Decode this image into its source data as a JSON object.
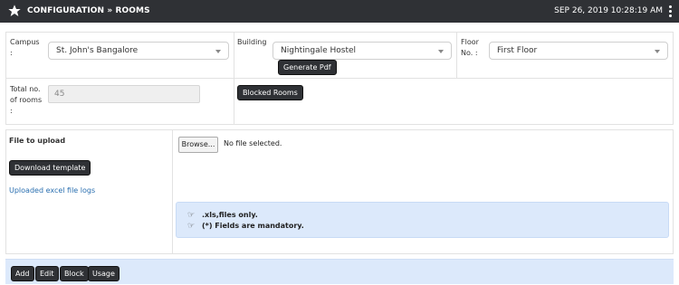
{
  "header": {
    "title": "CONFIGURATION » ROOMS",
    "datetime": "SEP 26, 2019  10:28:19 AM"
  },
  "filters": {
    "campus_label": "Campus :",
    "campus_value": "St. John's Bangalore",
    "building_label": "Building",
    "building_value": "Nightingale Hostel",
    "generate_pdf_label": "Generate Pdf",
    "floor_label": "Floor No. :",
    "floor_value": "First Floor"
  },
  "rooms": {
    "total_label": "Total no. of rooms :",
    "total_value": "45",
    "blocked_rooms_label": "Blocked Rooms"
  },
  "upload": {
    "file_label": "File to upload",
    "download_template_label": "Download template",
    "uploaded_logs_label": "Uploaded excel file logs",
    "browse_label": "Browse...",
    "no_file_text": "No file selected.",
    "notes": [
      ".xls,files only.",
      "(*) Fields are mandatory."
    ]
  },
  "footer": {
    "buttons": [
      "Add",
      "Edit",
      "Block",
      "Usage"
    ]
  },
  "colors": {
    "header_bg": "#2f3135",
    "notice_bg": "#dce9fb",
    "link": "#2a6fb0"
  }
}
